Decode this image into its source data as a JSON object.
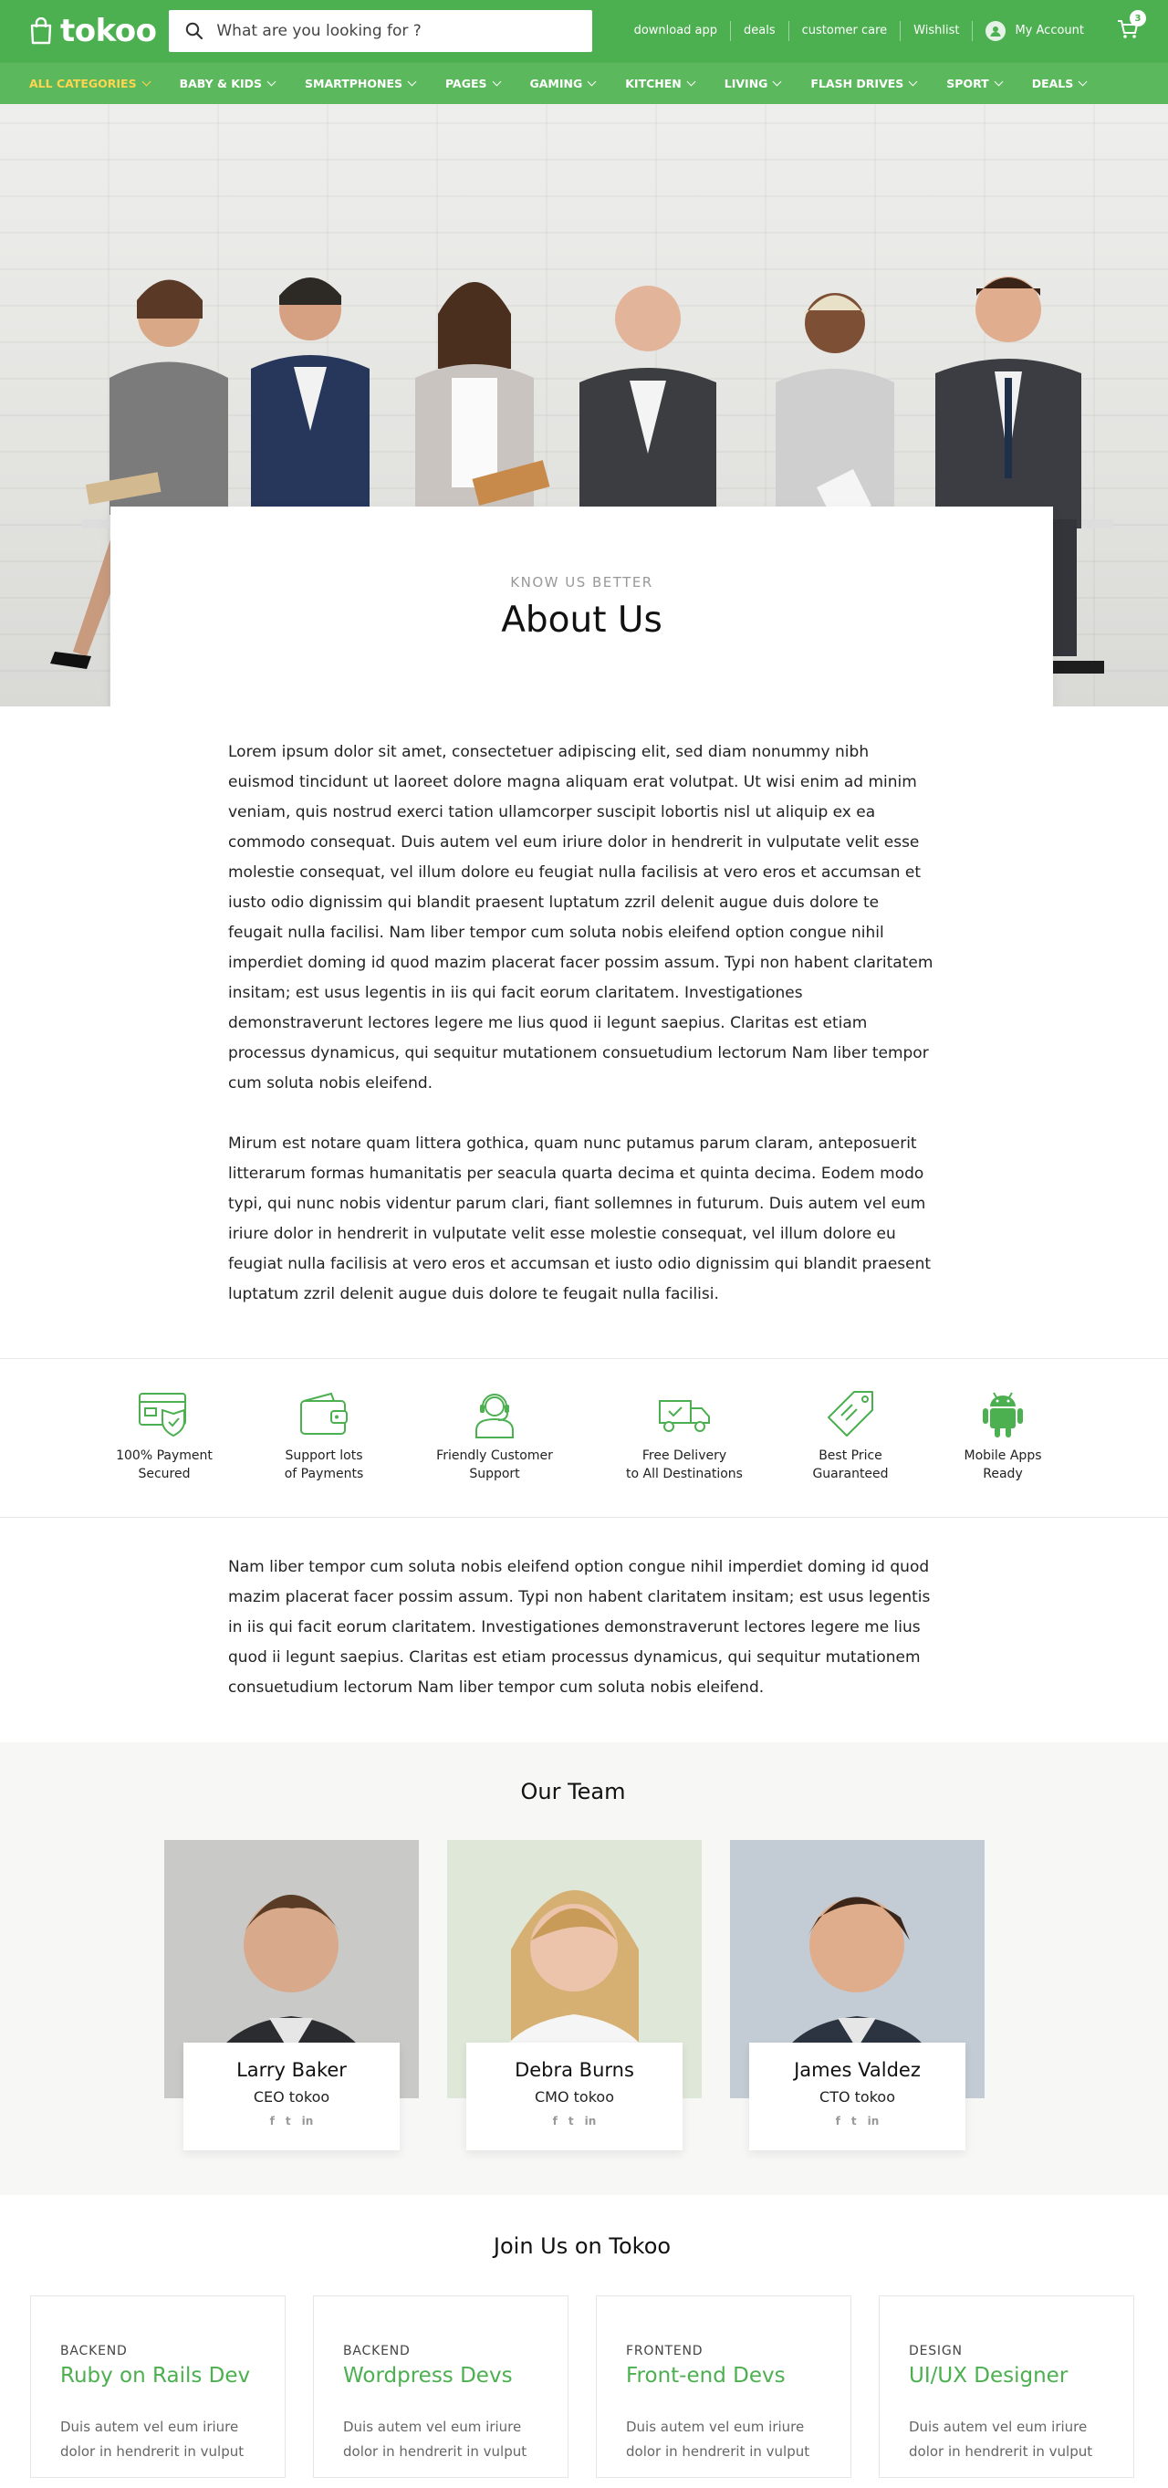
{
  "header": {
    "logo": "tokoo",
    "search_placeholder": "What are you looking for ?",
    "links": [
      "download app",
      "deals",
      "customer care",
      "Wishlist"
    ],
    "account_label": "My Account",
    "cart_count": "3"
  },
  "categories": [
    "ALL CATEGORIES",
    "BABY & KIDS",
    "SMARTPHONES",
    "PAGES",
    "GAMING",
    "KITCHEN",
    "LIVING",
    "FLASH DRIVES",
    "SPORT",
    "DEALS"
  ],
  "hero": {
    "eyebrow": "KNOW US BETTER",
    "title": "About Us"
  },
  "about": {
    "paragraph_1": "Lorem ipsum dolor sit amet, consectetuer adipiscing elit, sed diam nonummy nibh euismod tincidunt ut laoreet dolore magna aliquam erat volutpat. Ut wisi enim ad minim veniam, quis nostrud exerci tation ullamcorper suscipit lobortis nisl ut aliquip ex ea commodo consequat. Duis autem vel eum iriure dolor in hendrerit in vulputate velit esse molestie consequat, vel illum dolore eu feugiat nulla facilisis at vero eros et accumsan et iusto odio dignissim qui blandit praesent luptatum zzril delenit augue duis dolore te feugait nulla facilisi. Nam liber tempor cum soluta nobis eleifend option congue nihil imperdiet doming id quod mazim placerat facer possim assum. Typi non habent claritatem insitam; est usus legentis in iis qui facit eorum claritatem. Investigationes demonstraverunt lectores legere me lius quod ii legunt saepius. Claritas est etiam processus dynamicus, qui sequitur mutationem consuetudium lectorum Nam liber tempor cum soluta nobis eleifend.",
    "paragraph_2": "Mirum est notare quam littera gothica, quam nunc putamus parum claram, anteposuerit litterarum formas humanitatis per seacula quarta decima et quinta decima. Eodem modo typi, qui nunc nobis videntur parum clari, fiant sollemnes in futurum. Duis autem vel eum iriure dolor in hendrerit in vulputate velit esse molestie consequat, vel illum dolore eu feugiat nulla facilisis at vero eros et accumsan et iusto odio dignissim qui blandit praesent luptatum zzril delenit augue duis dolore te feugait nulla facilisi.",
    "paragraph_3": "Nam liber tempor cum soluta nobis eleifend option congue nihil imperdiet doming id quod mazim placerat facer possim assum. Typi non habent claritatem insitam; est usus legentis in iis qui facit eorum claritatem. Investigationes demonstraverunt lectores legere me lius quod ii legunt saepius. Claritas est etiam processus dynamicus, qui sequitur mutationem consuetudium lectorum Nam liber tempor cum soluta nobis eleifend."
  },
  "features": [
    {
      "line1": "100% Payment",
      "line2": "Secured",
      "icon": "secure-payment-icon"
    },
    {
      "line1": "Support lots",
      "line2": "of Payments",
      "icon": "wallet-icon"
    },
    {
      "line1": "Friendly Customer",
      "line2": "Support",
      "icon": "support-agent-icon"
    },
    {
      "line1": "Free Delivery",
      "line2": "to All Destinations",
      "icon": "delivery-truck-icon"
    },
    {
      "line1": "Best Price",
      "line2": "Guaranteed",
      "icon": "price-tag-icon"
    },
    {
      "line1": "Mobile Apps",
      "line2": "Ready",
      "icon": "android-icon"
    }
  ],
  "team": {
    "title": "Our Team",
    "members": [
      {
        "name": "Larry Baker",
        "role": "CEO tokoo"
      },
      {
        "name": "Debra Burns",
        "role": "CMO tokoo"
      },
      {
        "name": "James Valdez",
        "role": "CTO tokoo"
      }
    ],
    "social": [
      "f",
      "t",
      "in"
    ]
  },
  "join": {
    "title": "Join Us on Tokoo",
    "jobs": [
      {
        "tag": "BACKEND",
        "title": "Ruby on Rails Dev",
        "desc": "Duis autem vel eum iriure dolor in hendrerit in vulput"
      },
      {
        "tag": "BACKEND",
        "title": "Wordpress Devs",
        "desc": "Duis autem vel eum iriure dolor in hendrerit in vulput"
      },
      {
        "tag": "FRONTEND",
        "title": "Front-end Devs",
        "desc": "Duis autem vel eum iriure dolor in hendrerit in vulput"
      },
      {
        "tag": "DESIGN",
        "title": "UI/UX Designer",
        "desc": "Duis autem vel eum iriure dolor in hendrerit in vulput"
      }
    ]
  },
  "colors": {
    "brand": "#4caf50",
    "accent": "#ffd54f"
  }
}
